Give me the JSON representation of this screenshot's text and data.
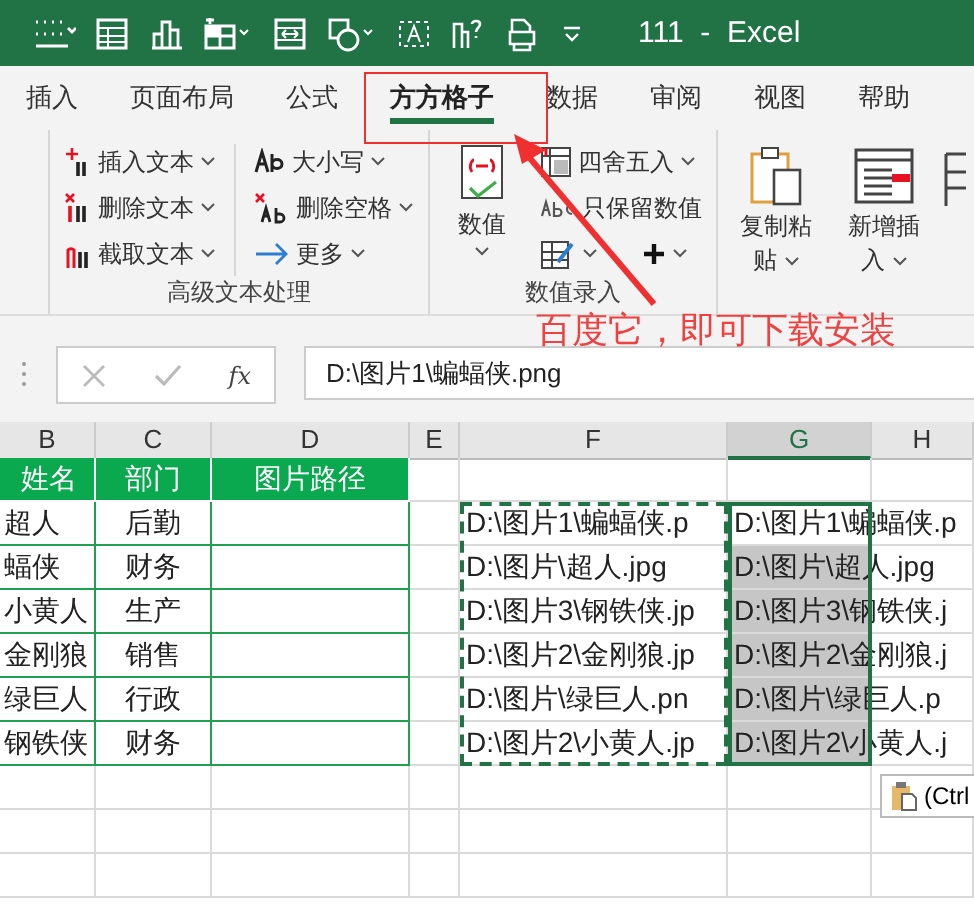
{
  "title_bar": {
    "title": "111  -  Excel"
  },
  "tabs": [
    {
      "label": "插入",
      "selected": false
    },
    {
      "label": "页面布局",
      "selected": false
    },
    {
      "label": "公式",
      "selected": false
    },
    {
      "label": "方方格子",
      "selected": true
    },
    {
      "label": "数据",
      "selected": false
    },
    {
      "label": "审阅",
      "selected": false
    },
    {
      "label": "视图",
      "selected": false
    },
    {
      "label": "帮助",
      "selected": false
    }
  ],
  "ribbon": {
    "text_group": {
      "label": "高级文本处理",
      "columns": [
        [
          {
            "kind": "insert",
            "label": "插入文本"
          },
          {
            "kind": "delete",
            "label": "删除文本"
          },
          {
            "kind": "extract",
            "label": "截取文本"
          }
        ],
        [
          {
            "kind": "case",
            "label": "大小写"
          },
          {
            "kind": "space",
            "label": "删除空格"
          },
          {
            "kind": "more",
            "label": "更多"
          }
        ]
      ]
    },
    "number_group": {
      "label": "数值录入",
      "big_button": "数值",
      "items": [
        {
          "kind": "round",
          "label": "四舍五入"
        },
        {
          "kind": "keep",
          "label": "只保留数值"
        }
      ]
    },
    "edit_group": {
      "buttons": [
        {
          "kind": "paste",
          "lines": [
            "复制粘",
            "贴"
          ]
        },
        {
          "kind": "insert-row",
          "lines": [
            "新增插",
            "入"
          ]
        }
      ]
    }
  },
  "annotation": {
    "text": "百度它，即可下载安装"
  },
  "formula_bar": {
    "function_label": "fx",
    "value": "D:\\图片1\\蝙蝠侠.png"
  },
  "sheet": {
    "columns": [
      {
        "label": "B",
        "selected": false
      },
      {
        "label": "C",
        "selected": false
      },
      {
        "label": "D",
        "selected": false
      },
      {
        "label": "E",
        "selected": false
      },
      {
        "label": "F",
        "selected": false
      },
      {
        "label": "G",
        "selected": true
      },
      {
        "label": "H",
        "selected": false
      }
    ],
    "rows": [
      {
        "kind": "header",
        "cells": {
          "B": "姓名",
          "C": "部门",
          "D": "图片路径"
        }
      },
      {
        "kind": "data",
        "selected": false,
        "cells": {
          "B": "超人",
          "C": "后勤",
          "F": "D:\\图片1\\蝙蝠侠.p",
          "G": "D:\\图片1\\蝙蝠侠.p"
        }
      },
      {
        "kind": "data",
        "selected": true,
        "cells": {
          "B": "蝠侠",
          "C": "财务",
          "F": "D:\\图片\\超人.jpg",
          "G": "D:\\图片\\超人.jpg"
        }
      },
      {
        "kind": "data",
        "selected": true,
        "cells": {
          "B": "小黄人",
          "C": "生产",
          "F": "D:\\图片3\\钢铁侠.jp",
          "G": "D:\\图片3\\钢铁侠.j"
        }
      },
      {
        "kind": "data",
        "selected": true,
        "cells": {
          "B": "金刚狼",
          "C": "销售",
          "F": "D:\\图片2\\金刚狼.jp",
          "G": "D:\\图片2\\金刚狼.j"
        }
      },
      {
        "kind": "data",
        "selected": true,
        "cells": {
          "B": "绿巨人",
          "C": "行政",
          "F": "D:\\图片\\绿巨人.pn",
          "G": "D:\\图片\\绿巨人.p"
        }
      },
      {
        "kind": "data",
        "selected": true,
        "cells": {
          "B": "钢铁侠",
          "C": "财务",
          "F": "D:\\图片2\\小黄人.jp",
          "G": "D:\\图片2\\小黄人.j"
        }
      }
    ],
    "paste_options": {
      "label": "(Ctrl"
    }
  }
}
